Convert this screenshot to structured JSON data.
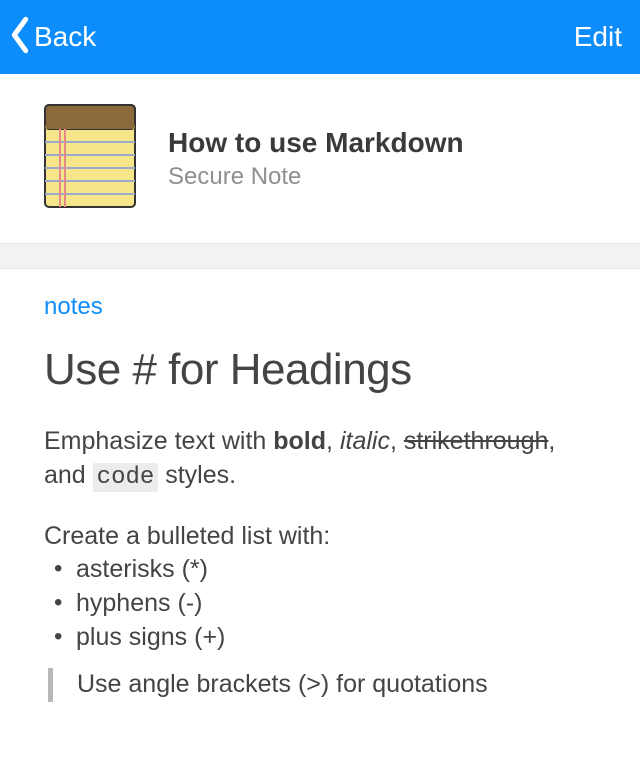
{
  "nav": {
    "back_label": "Back",
    "edit_label": "Edit"
  },
  "header": {
    "title": "How to use Markdown",
    "subtitle": "Secure Note"
  },
  "section_label": "notes",
  "content": {
    "heading": "Use # for Headings",
    "emphasis_prefix": "Emphasize text with ",
    "bold_word": "bold",
    "sep1": ", ",
    "italic_word": "italic",
    "sep2": ", ",
    "strike_word": "strikethrough",
    "sep3": ", and ",
    "code_word": "code",
    "emphasis_suffix": " styles.",
    "list_intro": "Create a bulleted list with:",
    "bullets": [
      "asterisks (*)",
      "hyphens (-)",
      "plus signs (+)"
    ],
    "quote_text": "Use angle brackets (>) for quotations"
  }
}
